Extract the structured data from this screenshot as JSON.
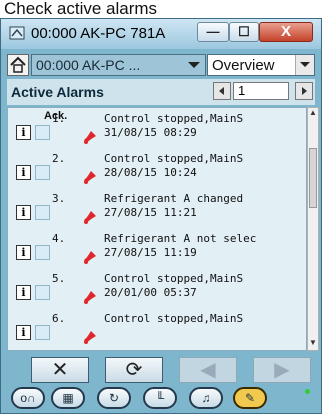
{
  "caption": "Check active alarms",
  "window": {
    "title": "00:000 AK-PC 781A",
    "controls": {
      "minimize": "—",
      "maximize": "☐",
      "close": "X"
    }
  },
  "toolbar": {
    "device": "00:000 AK-PC ...",
    "view": "Overview"
  },
  "header": {
    "title": "Active Alarms",
    "page": "1"
  },
  "list": {
    "ack_label": "Ack.",
    "alarms": [
      {
        "num": "1.",
        "message": "Control stopped,MainS",
        "time": "31/08/15 08:29"
      },
      {
        "num": "2.",
        "message": "Control stopped,MainS",
        "time": "28/08/15 10:24"
      },
      {
        "num": "3.",
        "message": "Refrigerant A changed",
        "time": "27/08/15 11:21"
      },
      {
        "num": "4.",
        "message": "Refrigerant A not selec",
        "time": "27/08/15 11:19"
      },
      {
        "num": "5.",
        "message": "Control stopped,MainS",
        "time": "20/01/00 05:37"
      },
      {
        "num": "6.",
        "message": "Control stopped,MainS",
        "time": ""
      }
    ]
  },
  "actions": {
    "clear": "✕",
    "refresh": "⟳",
    "prev": "◀",
    "next": "▶"
  },
  "bottom_nav": [
    {
      "name": "fans-icon",
      "glyph": "ᴏ∩"
    },
    {
      "name": "grid-icon",
      "glyph": "▦"
    },
    {
      "name": "cycle-icon",
      "glyph": "↻"
    },
    {
      "name": "chart-icon",
      "glyph": "╙"
    },
    {
      "name": "bell-icon",
      "glyph": "♫"
    },
    {
      "name": "wrench-icon",
      "glyph": "✎"
    }
  ],
  "colors": {
    "bell": "#e0262b",
    "status_dot": "#2ecb3a"
  }
}
